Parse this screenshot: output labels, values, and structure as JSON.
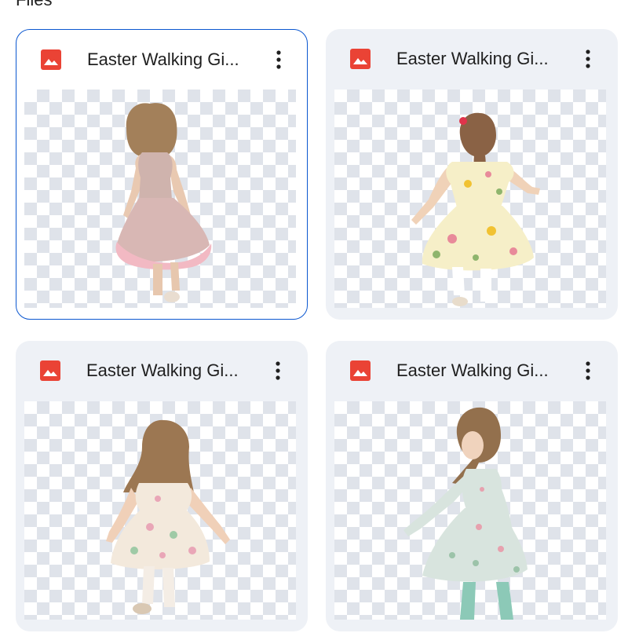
{
  "section": {
    "label": "Files"
  },
  "files": [
    {
      "name": "Easter Walking Gi...",
      "type_icon": "image-icon",
      "menu_icon": "more-vert-icon",
      "selected": true
    },
    {
      "name": "Easter Walking Gi...",
      "type_icon": "image-icon",
      "menu_icon": "more-vert-icon",
      "selected": false
    },
    {
      "name": "Easter Walking Gi...",
      "type_icon": "image-icon",
      "menu_icon": "more-vert-icon",
      "selected": false
    },
    {
      "name": "Easter Walking Gi...",
      "type_icon": "image-icon",
      "menu_icon": "more-vert-icon",
      "selected": false
    }
  ],
  "colors": {
    "accent": "#0b57d0",
    "card_bg": "#eef1f6",
    "image_icon": "#ea4335"
  }
}
